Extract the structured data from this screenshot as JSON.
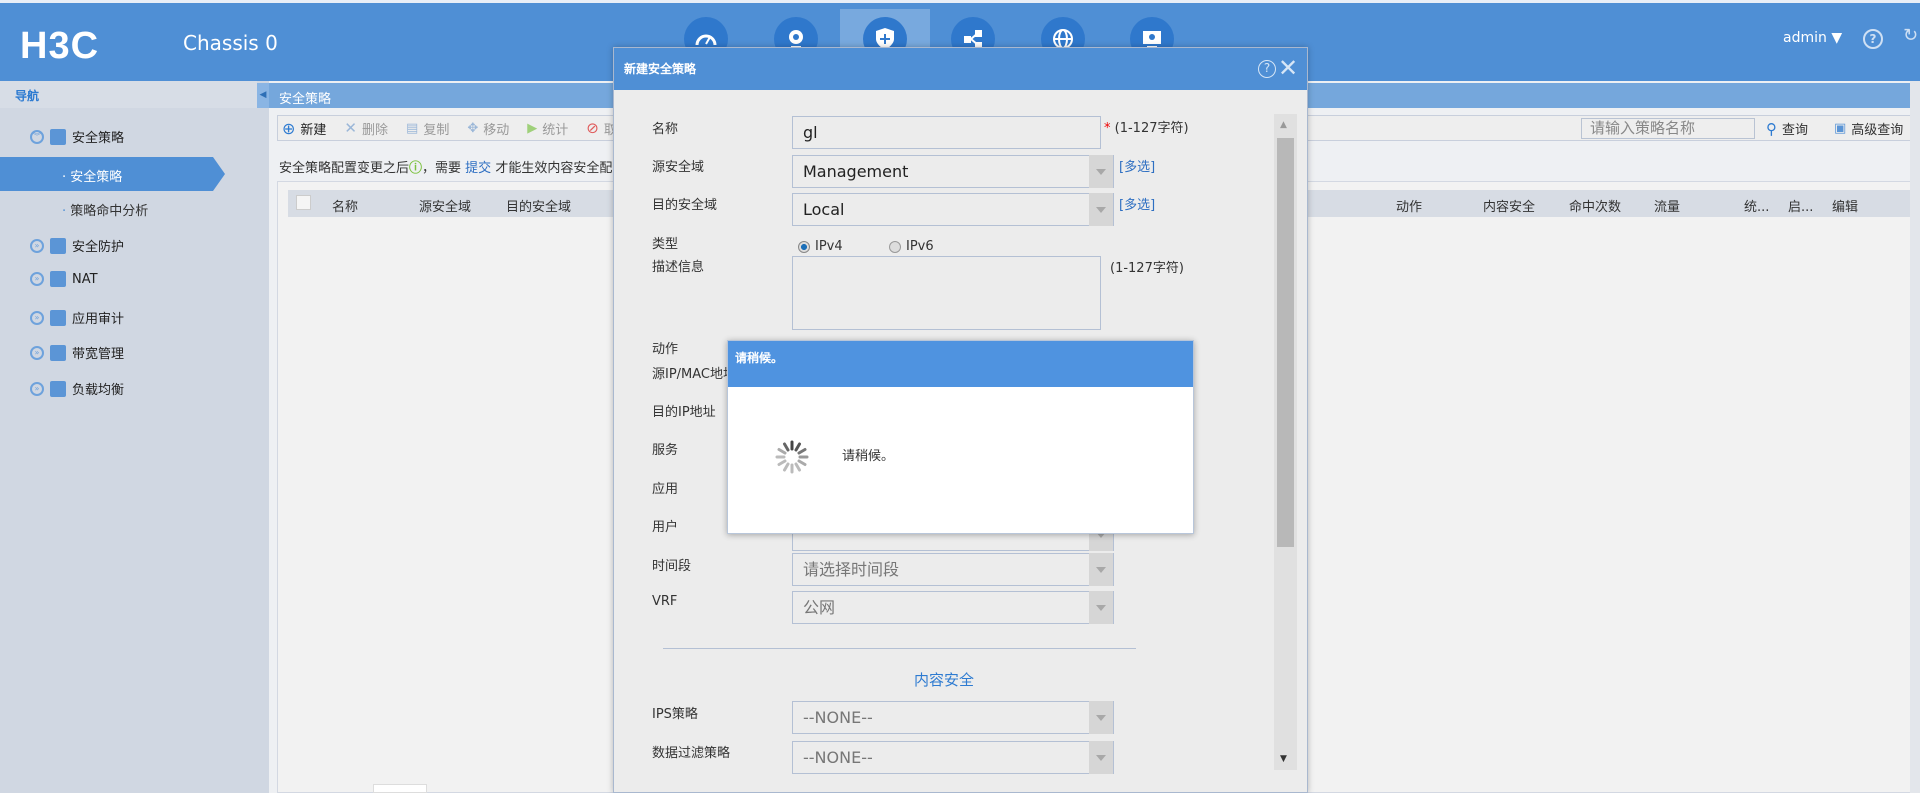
{
  "header": {
    "logo": "H3C",
    "title": "Chassis 0",
    "user": "admin",
    "nav_icons": [
      "dashboard-icon",
      "monitor-camera-icon",
      "security-shield-icon",
      "network-share-icon",
      "globe-icon",
      "system-settings-icon"
    ],
    "active_nav": "security-shield-icon"
  },
  "sidebar": {
    "title": "导航",
    "items": [
      {
        "label": "安全策略",
        "expanded": true,
        "children": [
          {
            "label": "安全策略",
            "active": true
          },
          {
            "label": "策略命中分析"
          }
        ]
      },
      {
        "label": "安全防护"
      },
      {
        "label": "NAT"
      },
      {
        "label": "应用审计"
      },
      {
        "label": "带宽管理"
      },
      {
        "label": "负载均衡"
      }
    ]
  },
  "main": {
    "breadcrumb": "安全策略",
    "toolbar": {
      "new": "新建",
      "delete": "删除",
      "copy": "复制",
      "move": "移动",
      "stats": "统计",
      "disable": "取",
      "search_placeholder": "请输入策略名称",
      "query": "查询",
      "advanced_query": "高级查询"
    },
    "info": {
      "before": "安全策略配置变更之后",
      "mid": "，需要 ",
      "link": "提交",
      "after": " 才能生效内容安全配置"
    },
    "columns": [
      "名称",
      "源安全域",
      "目的安全域",
      "动作",
      "内容安全",
      "命中次数",
      "流量",
      "统...",
      "启...",
      "编辑"
    ]
  },
  "dialog": {
    "title": "新建安全策略",
    "fields": {
      "name_label": "名称",
      "name_value": "gl",
      "name_hint": "(1-127字符)",
      "src_zone_label": "源安全域",
      "src_zone_value": "Management",
      "dst_zone_label": "目的安全域",
      "dst_zone_value": "Local",
      "multi": "[多选]",
      "type_label": "类型",
      "ipv4": "IPv4",
      "ipv6": "IPv6",
      "type_selected": "IPv4",
      "desc_label": "描述信息",
      "desc_hint": "(1-127字符)",
      "action_label": "动作",
      "src_ip_label": "源IP/MAC地址",
      "dst_ip_label": "目的IP地址",
      "service_label": "服务",
      "app_label": "应用",
      "user_label": "用户",
      "time_label": "时间段",
      "time_placeholder": "请选择时间段",
      "vrf_label": "VRF",
      "vrf_value": "公网",
      "content_security": "内容安全",
      "ips_label": "IPS策略",
      "ips_value": "--NONE--",
      "filter_label": "数据过滤策略",
      "filter_value": "--NONE--"
    }
  },
  "loading": {
    "title": "请稍候。",
    "message": "请稍候。"
  },
  "colors": {
    "header": "#4f8fd5",
    "accent": "#2e7bd1",
    "sidebar": "#d0d7e2"
  }
}
